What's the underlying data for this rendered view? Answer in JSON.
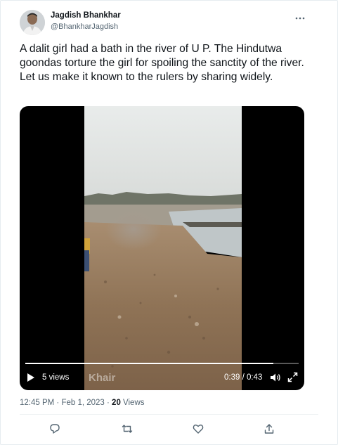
{
  "author": {
    "name": "Jagdish Bhankhar",
    "handle": "@BhankharJagdish"
  },
  "tweet": {
    "text": "A dalit girl had a bath in the river of U P. The Hindutwa goondas torture the girl for spoiling the sanctity of the river. Let us make it known to the rulers by sharing widely."
  },
  "video": {
    "views_label": "5 views",
    "watermark": "Khair",
    "time_label": "0:39 / 0:43",
    "progress": 0.907
  },
  "meta": {
    "timestamp": "12:45 PM · Feb 1, 2023 · ",
    "views_count": "20",
    "views_word": " Views"
  },
  "icons": {
    "more": "more-horizontal-icon",
    "play": "play-icon",
    "volume": "volume-icon",
    "fullscreen": "fullscreen-icon",
    "reply": "reply-icon",
    "retweet": "retweet-icon",
    "like": "like-icon",
    "share": "share-icon"
  },
  "colors": {
    "text_primary": "#0f1419",
    "text_secondary": "#536471",
    "video_bg": "#000000"
  }
}
